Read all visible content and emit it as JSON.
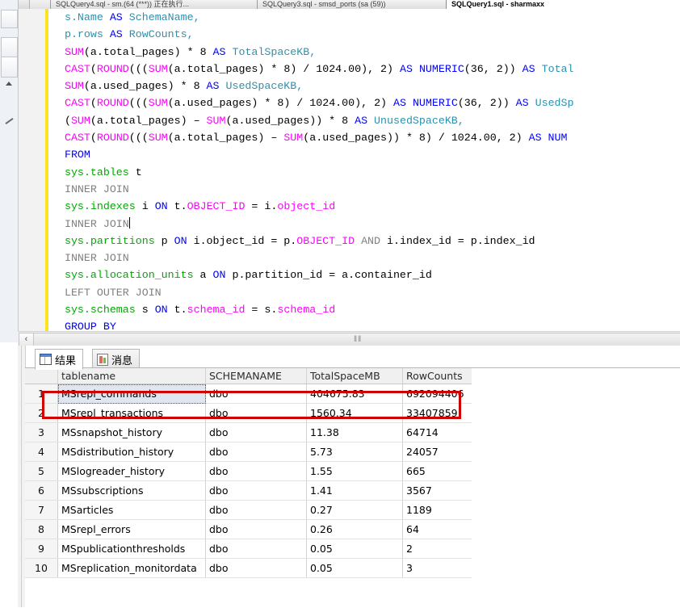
{
  "window": {
    "tabs": [
      {
        "label": "SQLQuery4.sql - sm.(64 (***)) 正在执行...",
        "active": false
      },
      {
        "label": "SQLQuery3.sql - smsd_ports (sa (59))",
        "active": false
      },
      {
        "label": "SQLQuery1.sql - sharmaxx",
        "active": true
      }
    ]
  },
  "editor": {
    "change_bar_color": "#fbe31e",
    "caret_line": 12,
    "lines": [
      [
        {
          "t": "  ",
          "c": "pl"
        },
        {
          "t": "s.Name ",
          "c": "id"
        },
        {
          "t": "AS",
          "c": "k"
        },
        {
          "t": " SchemaName,",
          "c": "id"
        }
      ],
      [
        {
          "t": "  ",
          "c": "pl"
        },
        {
          "t": "p.rows ",
          "c": "id"
        },
        {
          "t": "AS",
          "c": "k"
        },
        {
          "t": " RowCounts,",
          "c": "id"
        }
      ],
      [
        {
          "t": "  ",
          "c": "pl"
        },
        {
          "t": "SUM",
          "c": "fn"
        },
        {
          "t": "(a.total_pages) * ",
          "c": "pl"
        },
        {
          "t": "8",
          "c": "num"
        },
        {
          "t": " AS",
          "c": "k"
        },
        {
          "t": " TotalSpaceKB,",
          "c": "id"
        }
      ],
      [
        {
          "t": "  ",
          "c": "pl"
        },
        {
          "t": "CAST",
          "c": "fn"
        },
        {
          "t": "(",
          "c": "pl"
        },
        {
          "t": "ROUND",
          "c": "fn"
        },
        {
          "t": "(((",
          "c": "pl"
        },
        {
          "t": "SUM",
          "c": "fn"
        },
        {
          "t": "(a.total_pages) * ",
          "c": "pl"
        },
        {
          "t": "8",
          "c": "num"
        },
        {
          "t": ") / ",
          "c": "pl"
        },
        {
          "t": "1024.00",
          "c": "num"
        },
        {
          "t": "), ",
          "c": "pl"
        },
        {
          "t": "2",
          "c": "num"
        },
        {
          "t": ") ",
          "c": "pl"
        },
        {
          "t": "AS NUMERIC",
          "c": "k"
        },
        {
          "t": "(",
          "c": "pl"
        },
        {
          "t": "36",
          "c": "num"
        },
        {
          "t": ", ",
          "c": "pl"
        },
        {
          "t": "2",
          "c": "num"
        },
        {
          "t": ")) ",
          "c": "pl"
        },
        {
          "t": "AS",
          "c": "k"
        },
        {
          "t": " Total",
          "c": "id"
        }
      ],
      [
        {
          "t": "  ",
          "c": "pl"
        },
        {
          "t": "SUM",
          "c": "fn"
        },
        {
          "t": "(a.used_pages) * ",
          "c": "pl"
        },
        {
          "t": "8",
          "c": "num"
        },
        {
          "t": " AS",
          "c": "k"
        },
        {
          "t": " UsedSpaceKB,",
          "c": "id"
        }
      ],
      [
        {
          "t": "  ",
          "c": "pl"
        },
        {
          "t": "CAST",
          "c": "fn"
        },
        {
          "t": "(",
          "c": "pl"
        },
        {
          "t": "ROUND",
          "c": "fn"
        },
        {
          "t": "(((",
          "c": "pl"
        },
        {
          "t": "SUM",
          "c": "fn"
        },
        {
          "t": "(a.used_pages) * ",
          "c": "pl"
        },
        {
          "t": "8",
          "c": "num"
        },
        {
          "t": ") / ",
          "c": "pl"
        },
        {
          "t": "1024.00",
          "c": "num"
        },
        {
          "t": "), ",
          "c": "pl"
        },
        {
          "t": "2",
          "c": "num"
        },
        {
          "t": ") ",
          "c": "pl"
        },
        {
          "t": "AS NUMERIC",
          "c": "k"
        },
        {
          "t": "(",
          "c": "pl"
        },
        {
          "t": "36",
          "c": "num"
        },
        {
          "t": ", ",
          "c": "pl"
        },
        {
          "t": "2",
          "c": "num"
        },
        {
          "t": ")) ",
          "c": "pl"
        },
        {
          "t": "AS",
          "c": "k"
        },
        {
          "t": " UsedSp",
          "c": "id"
        }
      ],
      [
        {
          "t": "  (",
          "c": "pl"
        },
        {
          "t": "SUM",
          "c": "fn"
        },
        {
          "t": "(a.total_pages) ",
          "c": "pl"
        },
        {
          "t": "–",
          "c": "pl"
        },
        {
          "t": " ",
          "c": "pl"
        },
        {
          "t": "SUM",
          "c": "fn"
        },
        {
          "t": "(a.used_pages)) * ",
          "c": "pl"
        },
        {
          "t": "8",
          "c": "num"
        },
        {
          "t": " AS",
          "c": "k"
        },
        {
          "t": " UnusedSpaceKB,",
          "c": "id"
        }
      ],
      [
        {
          "t": "  ",
          "c": "pl"
        },
        {
          "t": "CAST",
          "c": "fn"
        },
        {
          "t": "(",
          "c": "pl"
        },
        {
          "t": "ROUND",
          "c": "fn"
        },
        {
          "t": "(((",
          "c": "pl"
        },
        {
          "t": "SUM",
          "c": "fn"
        },
        {
          "t": "(a.total_pages) ",
          "c": "pl"
        },
        {
          "t": "–",
          "c": "pl"
        },
        {
          "t": " ",
          "c": "pl"
        },
        {
          "t": "SUM",
          "c": "fn"
        },
        {
          "t": "(a.used_pages)) * ",
          "c": "pl"
        },
        {
          "t": "8",
          "c": "num"
        },
        {
          "t": ") / ",
          "c": "pl"
        },
        {
          "t": "1024.00",
          "c": "num"
        },
        {
          "t": ", ",
          "c": "pl"
        },
        {
          "t": "2",
          "c": "num"
        },
        {
          "t": ") ",
          "c": "pl"
        },
        {
          "t": "AS NUM",
          "c": "k"
        }
      ],
      [
        {
          "t": "  ",
          "c": "pl"
        },
        {
          "t": "FROM",
          "c": "k"
        }
      ],
      [
        {
          "t": "  ",
          "c": "pl"
        },
        {
          "t": "sys.tables",
          "c": "obj"
        },
        {
          "t": " t",
          "c": "pl"
        }
      ],
      [
        {
          "t": "  ",
          "c": "pl"
        },
        {
          "t": "INNER JOIN",
          "c": "kg"
        }
      ],
      [
        {
          "t": "  ",
          "c": "pl"
        },
        {
          "t": "sys.indexes",
          "c": "obj"
        },
        {
          "t": " i ",
          "c": "pl"
        },
        {
          "t": "ON",
          "c": "k"
        },
        {
          "t": " t.",
          "c": "pl"
        },
        {
          "t": "OBJECT_ID",
          "c": "fn"
        },
        {
          "t": " = i.",
          "c": "pl"
        },
        {
          "t": "object_id",
          "c": "pk"
        }
      ],
      [
        {
          "t": "  ",
          "c": "pl"
        },
        {
          "t": "INNER JOIN",
          "c": "kg"
        },
        {
          "t": "|",
          "c": "cursor"
        }
      ],
      [
        {
          "t": "  ",
          "c": "pl"
        },
        {
          "t": "sys.partitions",
          "c": "obj"
        },
        {
          "t": " p ",
          "c": "pl"
        },
        {
          "t": "ON",
          "c": "k"
        },
        {
          "t": " i.object_id = p.",
          "c": "pl"
        },
        {
          "t": "OBJECT_ID",
          "c": "fn"
        },
        {
          "t": " ",
          "c": "pl"
        },
        {
          "t": "AND",
          "c": "kg"
        },
        {
          "t": " i.index_id = p.index_id",
          "c": "pl"
        }
      ],
      [
        {
          "t": "  ",
          "c": "pl"
        },
        {
          "t": "INNER JOIN",
          "c": "kg"
        }
      ],
      [
        {
          "t": "  ",
          "c": "pl"
        },
        {
          "t": "sys.allocation_units",
          "c": "obj"
        },
        {
          "t": " a ",
          "c": "pl"
        },
        {
          "t": "ON",
          "c": "k"
        },
        {
          "t": " p.partition_id = a.container_id",
          "c": "pl"
        }
      ],
      [
        {
          "t": "  ",
          "c": "pl"
        },
        {
          "t": "LEFT OUTER JOIN",
          "c": "kg"
        }
      ],
      [
        {
          "t": "  ",
          "c": "pl"
        },
        {
          "t": "sys.schemas",
          "c": "obj"
        },
        {
          "t": " s ",
          "c": "pl"
        },
        {
          "t": "ON",
          "c": "k"
        },
        {
          "t": " t.",
          "c": "pl"
        },
        {
          "t": "schema_id",
          "c": "pk"
        },
        {
          "t": " = s.",
          "c": "pl"
        },
        {
          "t": "schema_id",
          "c": "pk"
        }
      ],
      [
        {
          "t": "  ",
          "c": "pl"
        },
        {
          "t": "GROUP BY",
          "c": "k"
        }
      ]
    ]
  },
  "scrollbar": {
    "left_arrow": "‹",
    "grip": "‖‖"
  },
  "results_pane": {
    "tabs": [
      {
        "name": "results-tab",
        "label": "结果",
        "icon": "grid-icon",
        "active": true
      },
      {
        "name": "messages-tab",
        "label": "消息",
        "icon": "message-icon",
        "active": false
      }
    ],
    "grid": {
      "columns": [
        "tablename",
        "SCHEMANAME",
        "TotalSpaceMB",
        "RowCounts"
      ],
      "rows": [
        {
          "n": "1",
          "tablename": "MSrepl_commands",
          "schema": "dbo",
          "total_space_mb": "404675.83",
          "row_counts": "692094406",
          "selected": true
        },
        {
          "n": "2",
          "tablename": "MSrepl_transactions",
          "schema": "dbo",
          "total_space_mb": "1560.34",
          "row_counts": "33407859",
          "selected": false
        },
        {
          "n": "3",
          "tablename": "MSsnapshot_history",
          "schema": "dbo",
          "total_space_mb": "11.38",
          "row_counts": "64714",
          "selected": false
        },
        {
          "n": "4",
          "tablename": "MSdistribution_history",
          "schema": "dbo",
          "total_space_mb": "5.73",
          "row_counts": "24057",
          "selected": false
        },
        {
          "n": "5",
          "tablename": "MSlogreader_history",
          "schema": "dbo",
          "total_space_mb": "1.55",
          "row_counts": "665",
          "selected": false
        },
        {
          "n": "6",
          "tablename": "MSsubscriptions",
          "schema": "dbo",
          "total_space_mb": "1.41",
          "row_counts": "3567",
          "selected": false
        },
        {
          "n": "7",
          "tablename": "MSarticles",
          "schema": "dbo",
          "total_space_mb": "0.27",
          "row_counts": "1189",
          "selected": false
        },
        {
          "n": "8",
          "tablename": "MSrepl_errors",
          "schema": "dbo",
          "total_space_mb": "0.26",
          "row_counts": "64",
          "selected": false
        },
        {
          "n": "9",
          "tablename": "MSpublicationthresholds",
          "schema": "dbo",
          "total_space_mb": "0.05",
          "row_counts": "2",
          "selected": false
        },
        {
          "n": "10",
          "tablename": "MSreplication_monitordata",
          "schema": "dbo",
          "total_space_mb": "0.05",
          "row_counts": "3",
          "selected": false
        }
      ]
    }
  },
  "annotation": {
    "highlight_color": "#cf0000",
    "target_row": "1"
  }
}
